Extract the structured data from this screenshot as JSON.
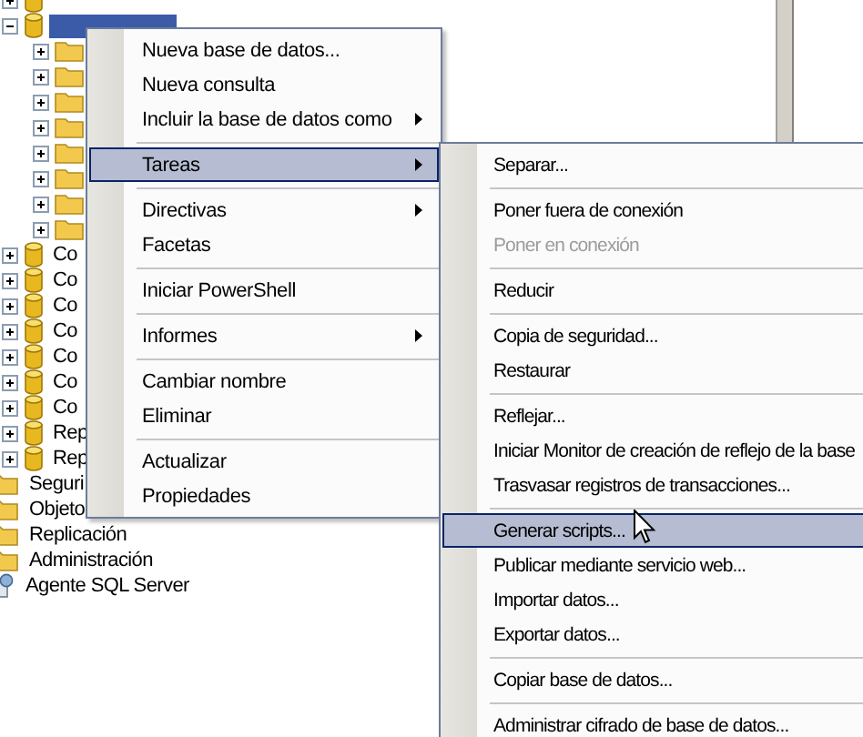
{
  "tree": {
    "items": [
      {
        "kind": "database",
        "expanded": false,
        "selected": false
      },
      {
        "kind": "database",
        "expanded": true,
        "selected": true,
        "children": [
          {
            "kind": "folder",
            "expanded": false,
            "selected": false
          },
          {
            "kind": "folder",
            "expanded": false,
            "selected": false
          },
          {
            "kind": "folder",
            "expanded": false,
            "selected": false
          },
          {
            "kind": "folder",
            "expanded": false,
            "selected": false
          },
          {
            "kind": "folder",
            "expanded": false,
            "selected": false
          },
          {
            "kind": "folder",
            "expanded": false,
            "selected": false
          },
          {
            "kind": "folder",
            "expanded": false,
            "selected": false
          },
          {
            "kind": "folder",
            "expanded": false,
            "selected": false
          }
        ]
      },
      {
        "kind": "database",
        "label": "Co",
        "expanded": false,
        "selected": false
      },
      {
        "kind": "database",
        "label": "Co",
        "expanded": false,
        "selected": false
      },
      {
        "kind": "database",
        "label": "Co",
        "expanded": false,
        "selected": false
      },
      {
        "kind": "database",
        "label": "Co",
        "expanded": false,
        "selected": false
      },
      {
        "kind": "database",
        "label": "Co",
        "expanded": false,
        "selected": false
      },
      {
        "kind": "database",
        "label": "Co",
        "expanded": false,
        "selected": false
      },
      {
        "kind": "database",
        "label": "Co",
        "expanded": false,
        "selected": false
      },
      {
        "kind": "database",
        "label": "Rep",
        "expanded": false,
        "selected": false
      },
      {
        "kind": "database",
        "label": "Rep",
        "expanded": false,
        "selected": false
      },
      {
        "kind": "category",
        "label": "Seguri",
        "selected": false
      },
      {
        "kind": "category",
        "label": "Objeto",
        "selected": false
      },
      {
        "kind": "category",
        "label": "Replicación",
        "selected": false
      },
      {
        "kind": "category",
        "label": "Administración",
        "selected": false
      },
      {
        "kind": "agent",
        "label": "Agente SQL Server",
        "selected": false
      }
    ]
  },
  "context_menu": {
    "items": [
      {
        "kind": "item",
        "label": "Nueva base de datos...",
        "has_submenu": false,
        "selected": false,
        "disabled": false
      },
      {
        "kind": "item",
        "label": "Nueva consulta",
        "has_submenu": false,
        "selected": false,
        "disabled": false
      },
      {
        "kind": "item",
        "label": "Incluir la base de datos como",
        "has_submenu": true,
        "selected": false,
        "disabled": false
      },
      {
        "kind": "separator"
      },
      {
        "kind": "item",
        "label": "Tareas",
        "has_submenu": true,
        "selected": true,
        "disabled": false
      },
      {
        "kind": "separator"
      },
      {
        "kind": "item",
        "label": "Directivas",
        "has_submenu": true,
        "selected": false,
        "disabled": false
      },
      {
        "kind": "item",
        "label": "Facetas",
        "has_submenu": false,
        "selected": false,
        "disabled": false
      },
      {
        "kind": "separator"
      },
      {
        "kind": "item",
        "label": "Iniciar PowerShell",
        "has_submenu": false,
        "selected": false,
        "disabled": false
      },
      {
        "kind": "separator"
      },
      {
        "kind": "item",
        "label": "Informes",
        "has_submenu": true,
        "selected": false,
        "disabled": false
      },
      {
        "kind": "separator"
      },
      {
        "kind": "item",
        "label": "Cambiar nombre",
        "has_submenu": false,
        "selected": false,
        "disabled": false
      },
      {
        "kind": "item",
        "label": "Eliminar",
        "has_submenu": false,
        "selected": false,
        "disabled": false
      },
      {
        "kind": "separator"
      },
      {
        "kind": "item",
        "label": "Actualizar",
        "has_submenu": false,
        "selected": false,
        "disabled": false
      },
      {
        "kind": "item",
        "label": "Propiedades",
        "has_submenu": false,
        "selected": false,
        "disabled": false
      }
    ]
  },
  "submenu": {
    "items": [
      {
        "kind": "item",
        "label": "Separar...",
        "has_submenu": false,
        "selected": false,
        "disabled": false
      },
      {
        "kind": "separator"
      },
      {
        "kind": "item",
        "label": "Poner fuera de conexión",
        "has_submenu": false,
        "selected": false,
        "disabled": false
      },
      {
        "kind": "item",
        "label": "Poner en conexión",
        "has_submenu": false,
        "selected": false,
        "disabled": true
      },
      {
        "kind": "separator"
      },
      {
        "kind": "item",
        "label": "Reducir",
        "has_submenu": false,
        "selected": false,
        "disabled": false
      },
      {
        "kind": "separator"
      },
      {
        "kind": "item",
        "label": "Copia de seguridad...",
        "has_submenu": false,
        "selected": false,
        "disabled": false
      },
      {
        "kind": "item",
        "label": "Restaurar",
        "has_submenu": false,
        "selected": false,
        "disabled": false
      },
      {
        "kind": "separator"
      },
      {
        "kind": "item",
        "label": "Reflejar...",
        "has_submenu": false,
        "selected": false,
        "disabled": false
      },
      {
        "kind": "item",
        "label": "Iniciar Monitor de creación de reflejo de la base",
        "has_submenu": false,
        "selected": false,
        "disabled": false
      },
      {
        "kind": "item",
        "label": "Trasvasar registros de transacciones...",
        "has_submenu": false,
        "selected": false,
        "disabled": false
      },
      {
        "kind": "separator"
      },
      {
        "kind": "item",
        "label": "Generar scripts...",
        "has_submenu": false,
        "selected": true,
        "disabled": false
      },
      {
        "kind": "item",
        "label": "Publicar mediante servicio web...",
        "has_submenu": false,
        "selected": false,
        "disabled": false
      },
      {
        "kind": "item",
        "label": "Importar datos...",
        "has_submenu": false,
        "selected": false,
        "disabled": false
      },
      {
        "kind": "item",
        "label": "Exportar datos...",
        "has_submenu": false,
        "selected": false,
        "disabled": false
      },
      {
        "kind": "separator"
      },
      {
        "kind": "item",
        "label": "Copiar base de datos...",
        "has_submenu": false,
        "selected": false,
        "disabled": false
      },
      {
        "kind": "separator"
      },
      {
        "kind": "item",
        "label": "Administrar cifrado de base de datos...",
        "has_submenu": false,
        "selected": false,
        "disabled": false
      }
    ]
  }
}
